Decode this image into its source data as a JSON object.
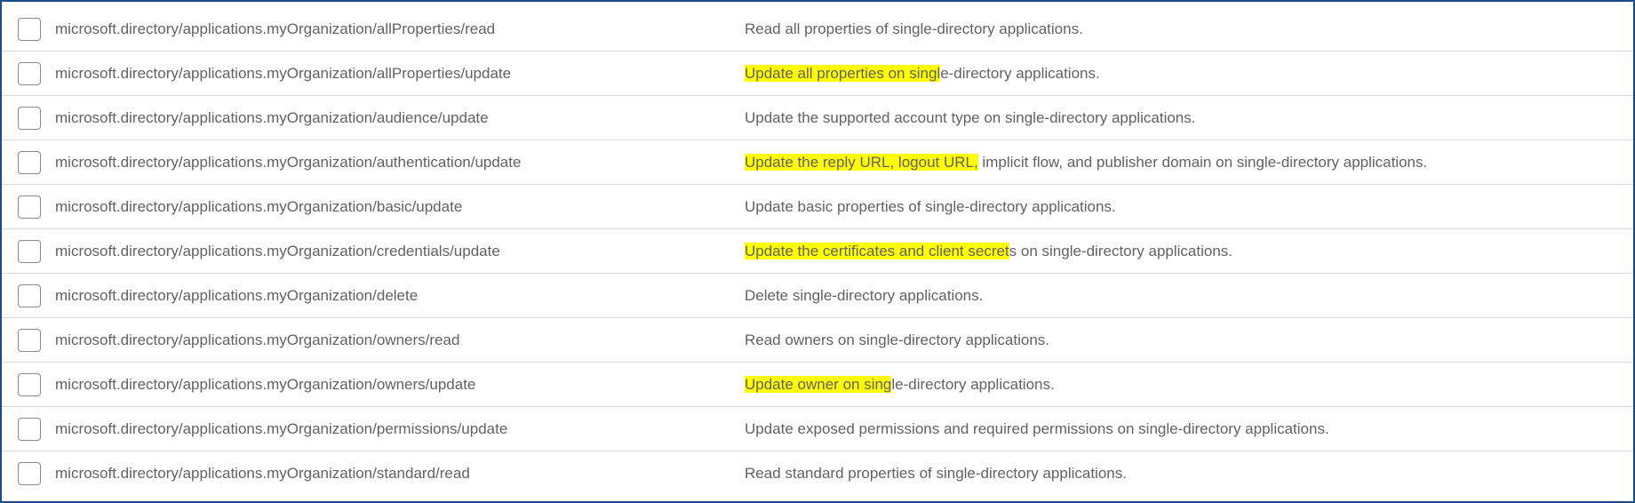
{
  "permissions": [
    {
      "action": "microsoft.directory/applications.myOrganization/allProperties/read",
      "description": "Read all properties of single-directory applications.",
      "highlight": null
    },
    {
      "action": "microsoft.directory/applications.myOrganization/allProperties/update",
      "description": "Update all properties on single-directory applications.",
      "highlight": "Update all properties on singl"
    },
    {
      "action": "microsoft.directory/applications.myOrganization/audience/update",
      "description": "Update the supported account type on single-directory applications.",
      "highlight": null
    },
    {
      "action": "microsoft.directory/applications.myOrganization/authentication/update",
      "description": "Update the reply URL, logout URL, implicit flow, and publisher domain on single-directory applications.",
      "highlight": "Update the reply URL, logout URL,"
    },
    {
      "action": "microsoft.directory/applications.myOrganization/basic/update",
      "description": "Update basic properties of single-directory applications.",
      "highlight": null
    },
    {
      "action": "microsoft.directory/applications.myOrganization/credentials/update",
      "description": "Update the certificates and client secrets on single-directory applications.",
      "highlight": "Update the certificates and client secret"
    },
    {
      "action": "microsoft.directory/applications.myOrganization/delete",
      "description": "Delete single-directory applications.",
      "highlight": null
    },
    {
      "action": "microsoft.directory/applications.myOrganization/owners/read",
      "description": "Read owners on single-directory applications.",
      "highlight": null
    },
    {
      "action": "microsoft.directory/applications.myOrganization/owners/update",
      "description": "Update owner on single-directory applications.",
      "highlight": "Update owner on sing"
    },
    {
      "action": "microsoft.directory/applications.myOrganization/permissions/update",
      "description": "Update exposed permissions and required permissions on single-directory applications.",
      "highlight": null
    },
    {
      "action": "microsoft.directory/applications.myOrganization/standard/read",
      "description": "Read standard properties of single-directory applications.",
      "highlight": null
    }
  ]
}
